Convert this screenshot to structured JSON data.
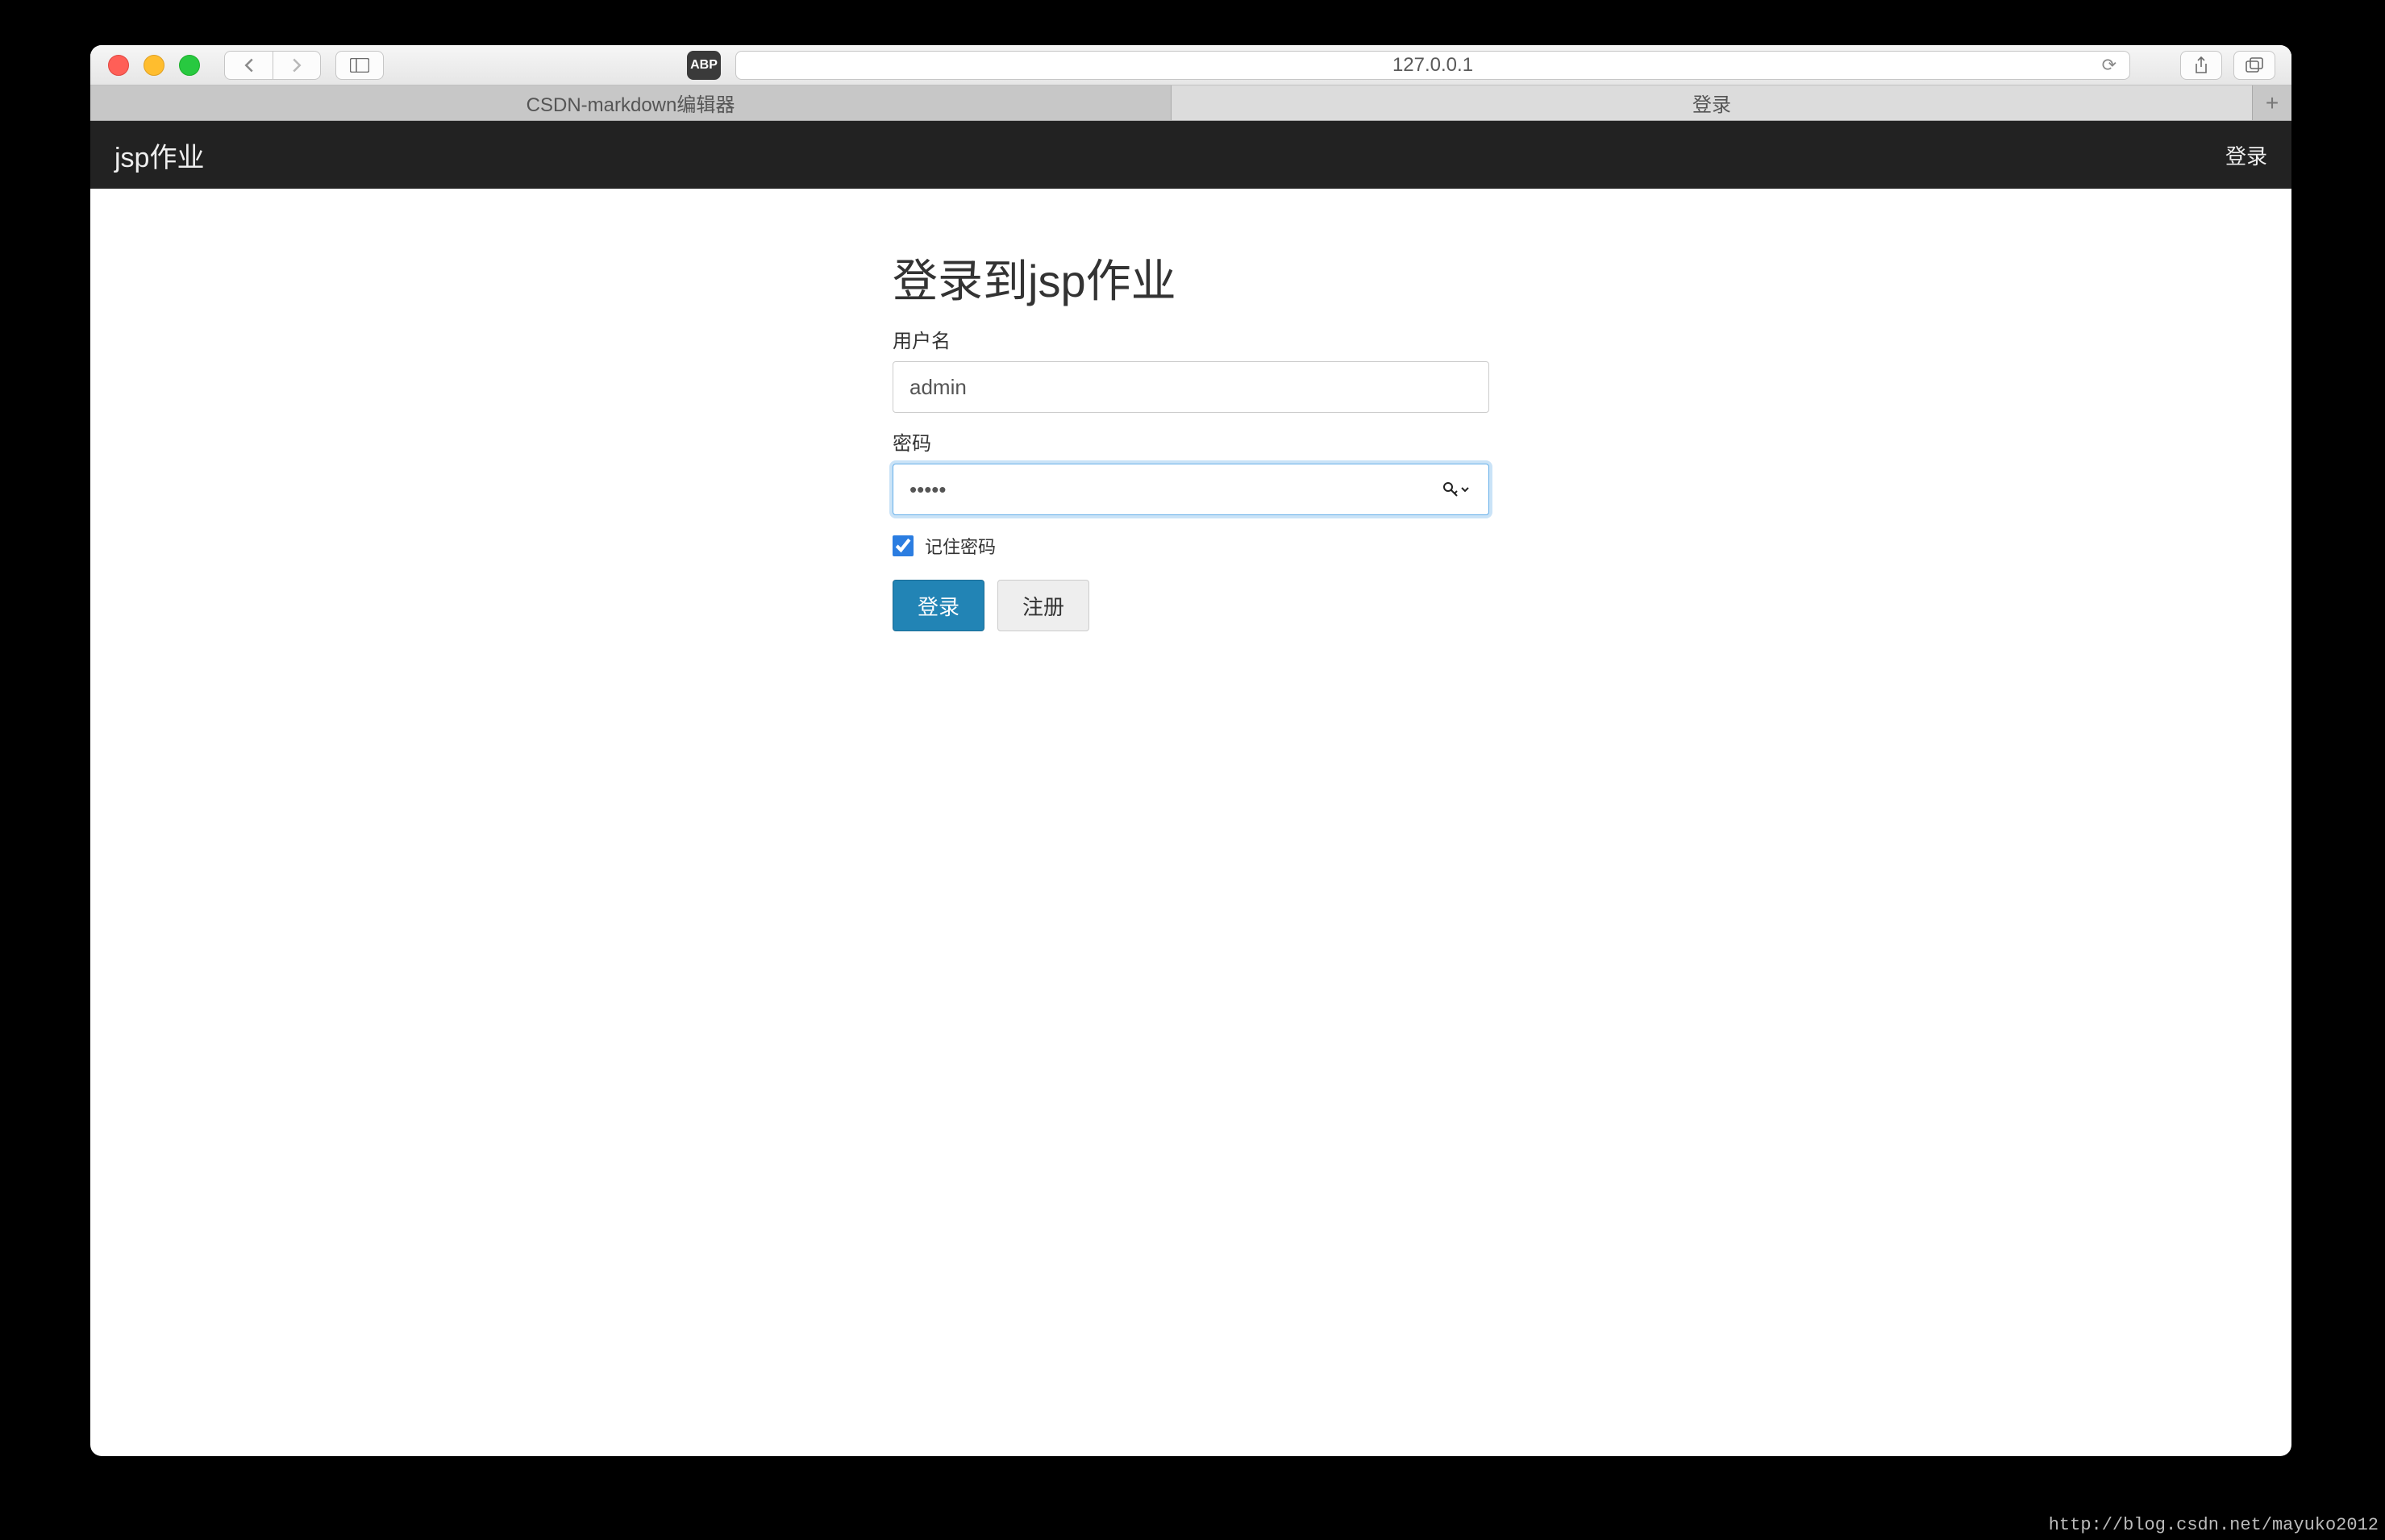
{
  "browser": {
    "address": "127.0.0.1",
    "adblock_label": "ABP",
    "tabs": [
      {
        "label": "CSDN-markdown编辑器",
        "active": false
      },
      {
        "label": "登录",
        "active": true
      }
    ]
  },
  "appbar": {
    "brand": "jsp作业",
    "login_link": "登录"
  },
  "form": {
    "heading": "登录到jsp作业",
    "username_label": "用户名",
    "username_value": "admin",
    "password_label": "密码",
    "password_value": "•••••",
    "remember_label": "记住密码",
    "remember_checked": true,
    "submit_label": "登录",
    "register_label": "注册"
  },
  "watermark": "http://blog.csdn.net/mayuko2012"
}
